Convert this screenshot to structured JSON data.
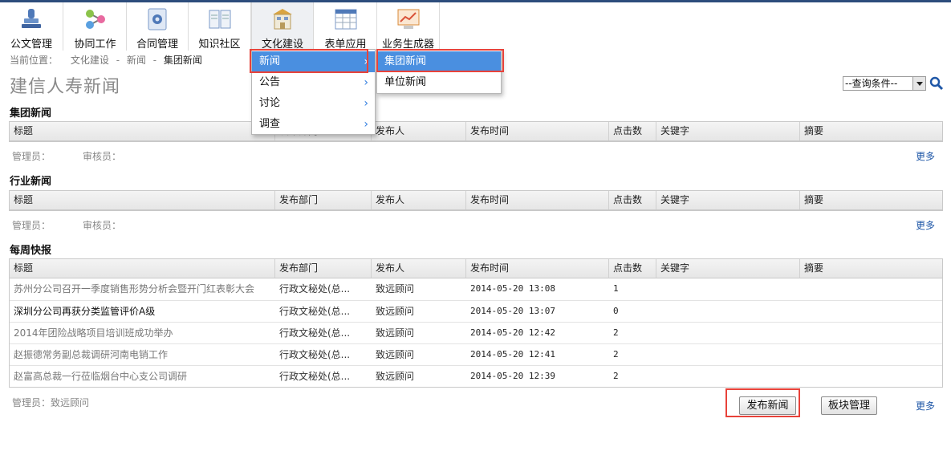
{
  "toolbar": {
    "items": [
      {
        "label": "公文管理",
        "icon": "stamp-icon"
      },
      {
        "label": "协同工作",
        "icon": "network-icon"
      },
      {
        "label": "合同管理",
        "icon": "gear-document-icon"
      },
      {
        "label": "知识社区",
        "icon": "book-icon"
      },
      {
        "label": "文化建设",
        "icon": "building-icon"
      },
      {
        "label": "表单应用",
        "icon": "grid-form-icon"
      },
      {
        "label": "业务生成器",
        "icon": "chart-screen-icon"
      }
    ]
  },
  "breadcrumb": {
    "prefix": "当前位置：",
    "items": [
      "文化建设",
      "新闻",
      "集团新闻"
    ],
    "separator": "-"
  },
  "page": {
    "title": "建信人寿新闻",
    "query_select": "--查询条件--"
  },
  "menu_main": {
    "items": [
      "新闻",
      "公告",
      "讨论",
      "调查"
    ]
  },
  "menu_sub": {
    "items": [
      "集团新闻",
      "单位新闻"
    ]
  },
  "columns": [
    "标题",
    "发布部门",
    "发布人",
    "发布时间",
    "点击数",
    "关键字",
    "摘要"
  ],
  "sections": [
    {
      "title": "集团新闻",
      "admin_label": "管理员：",
      "admin_value": "",
      "reviewer_label": "审核员：",
      "reviewer_value": "",
      "more": "更多"
    },
    {
      "title": "行业新闻",
      "admin_label": "管理员：",
      "admin_value": "",
      "reviewer_label": "审核员：",
      "reviewer_value": "",
      "more": "更多"
    },
    {
      "title": "每周快报",
      "admin_label": "管理员：",
      "admin_value": "致远顾问",
      "more": "更多",
      "rows": [
        {
          "title": "苏州分公司召开一季度销售形势分析会暨开门红表彰大会",
          "dept": "行政文秘处(总...",
          "author": "致远顾问",
          "time": "2014-05-20 13:08",
          "clicks": "1"
        },
        {
          "title": "深圳分公司再获分类监管评价A级",
          "dept": "行政文秘处(总...",
          "author": "致远顾问",
          "time": "2014-05-20 13:07",
          "clicks": "0"
        },
        {
          "title": "2014年团险战略项目培训班成功举办",
          "dept": "行政文秘处(总...",
          "author": "致远顾问",
          "time": "2014-05-20 12:42",
          "clicks": "2"
        },
        {
          "title": "赵振德常务副总裁调研河南电销工作",
          "dept": "行政文秘处(总...",
          "author": "致远顾问",
          "time": "2014-05-20 12:41",
          "clicks": "2"
        },
        {
          "title": "赵富高总裁一行莅临烟台中心支公司调研",
          "dept": "行政文秘处(总...",
          "author": "致远顾问",
          "time": "2014-05-20 12:39",
          "clicks": "2"
        }
      ]
    }
  ],
  "buttons": {
    "publish": "发布新闻",
    "board_manage": "板块管理"
  },
  "colors": {
    "menu_highlight": "#4a8fe0",
    "annotation_red": "#e8423a",
    "link_blue": "#1f57a7",
    "top_strip": "#2d4d7c"
  }
}
